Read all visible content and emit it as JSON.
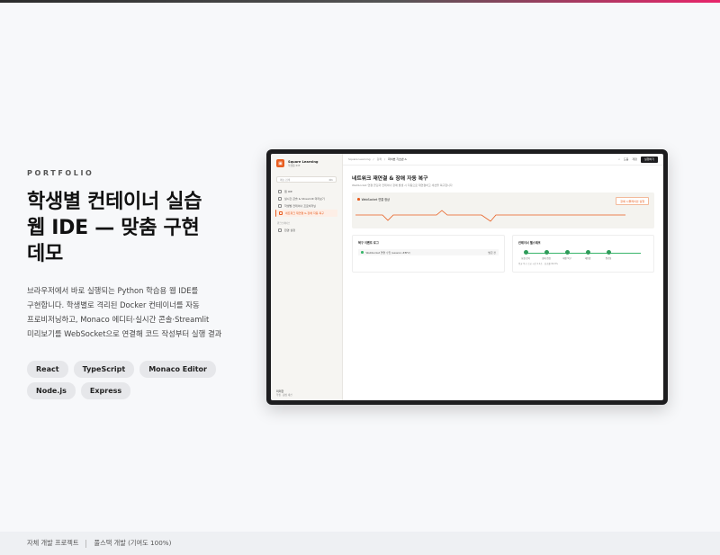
{
  "hero": {
    "eyebrow": "PORTFOLIO",
    "title_line1": "학생별 컨테이너 실습",
    "title_line2": "웹 IDE — 맞춤 구현",
    "title_line3": "데모",
    "desc_line1": "브라우저에서 바로 실행되는 Python 학습용 웹 IDE를",
    "desc_line2": "구현합니다. 학생별로 격리된 Docker 컨테이너를 자동",
    "desc_line3": "프로비저닝하고, Monaco 에디터·실시간 콘솔·Streamlit",
    "desc_line4": "미리보기를 WebSocket으로 연결해 코드 작성부터 실행 결과",
    "tags": [
      "React",
      "TypeScript",
      "Monaco Editor",
      "Node.js",
      "Express"
    ]
  },
  "footer": {
    "left": "자체 개발 프로젝트",
    "right": "풀스택 개발 (기여도 100%)"
  },
  "mockup": {
    "brand_name": "Square Learning",
    "brand_sub": "학생용 IDE",
    "search_placeholder": "메뉴 검색",
    "search_shortcut": "⌘K",
    "sidebar_items": [
      "웹 IDE",
      "실시간 콘솔 & Streamlit 미리보기",
      "학생별 컨테이너 프로비저닝",
      "네트워크 재연결 & 장애 자동 복구"
    ],
    "sidebar_section": "워크스페이스",
    "sidebar_extra": "환경 설정",
    "user_name": "미리한",
    "user_role": "학생 · 활성 세션",
    "crumbs": [
      "Square Learning",
      "강좌",
      "파이썬 기초반 A"
    ],
    "top_help": "도움",
    "top_user": "계정",
    "top_button": "실행하기",
    "page_title": "네트워크 재연결 & 장애 자동 복구",
    "page_sub": "WebSocket 연결 끊김과 컨테이너 장애 발생 시 자동으로 재연결하고 세션을 복구합니다",
    "ws_status": "WebSocket 연결 정상",
    "retry_button": "장애 시뮬레이션 실행",
    "log_title": "복구 이벤트 로그",
    "log_entry": "WebSocket 연결 수립 (session #8F2)",
    "log_time": "방금 전",
    "health_title": "컨테이너 헬스체크",
    "health_steps": [
      "요청 감지",
      "상태 점검",
      "재생 복구",
      "재연결",
      "완료됨"
    ],
    "health_foot": "평균 복구 소요 시간 2.4초 · 성공률 99.8%"
  }
}
